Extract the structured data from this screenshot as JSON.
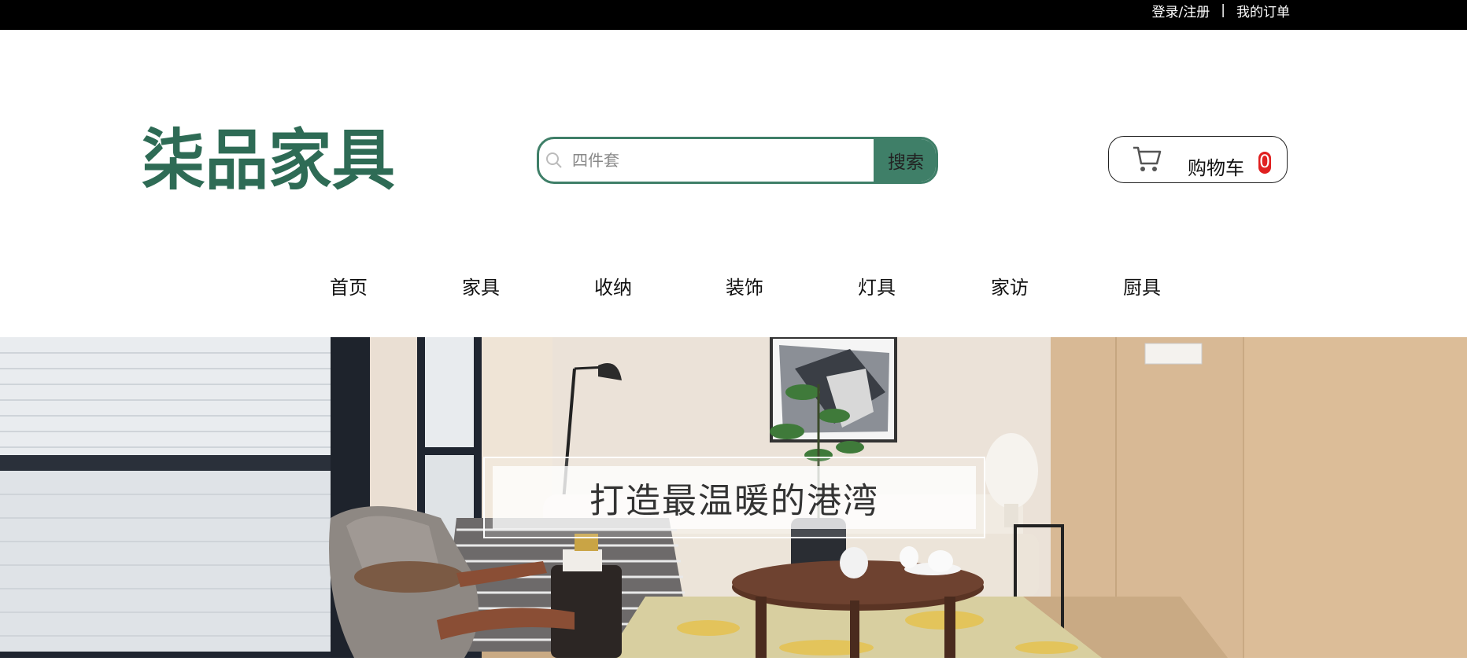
{
  "topbar": {
    "login": "登录/注册",
    "separator": "|",
    "orders": "我的订单"
  },
  "brand": {
    "logo_text": "柒品家具",
    "color": "#2e6b55"
  },
  "search": {
    "placeholder": "四件套",
    "button": "搜索",
    "icon": "search-icon",
    "accent": "#3f7f68"
  },
  "cart": {
    "label": "购物车",
    "count": "0",
    "icon": "cart-icon"
  },
  "nav": {
    "items": [
      "首页",
      "家具",
      "收纳",
      "装饰",
      "灯具",
      "家访",
      "厨具"
    ]
  },
  "banner": {
    "slogan": "打造最温暖的港湾"
  }
}
